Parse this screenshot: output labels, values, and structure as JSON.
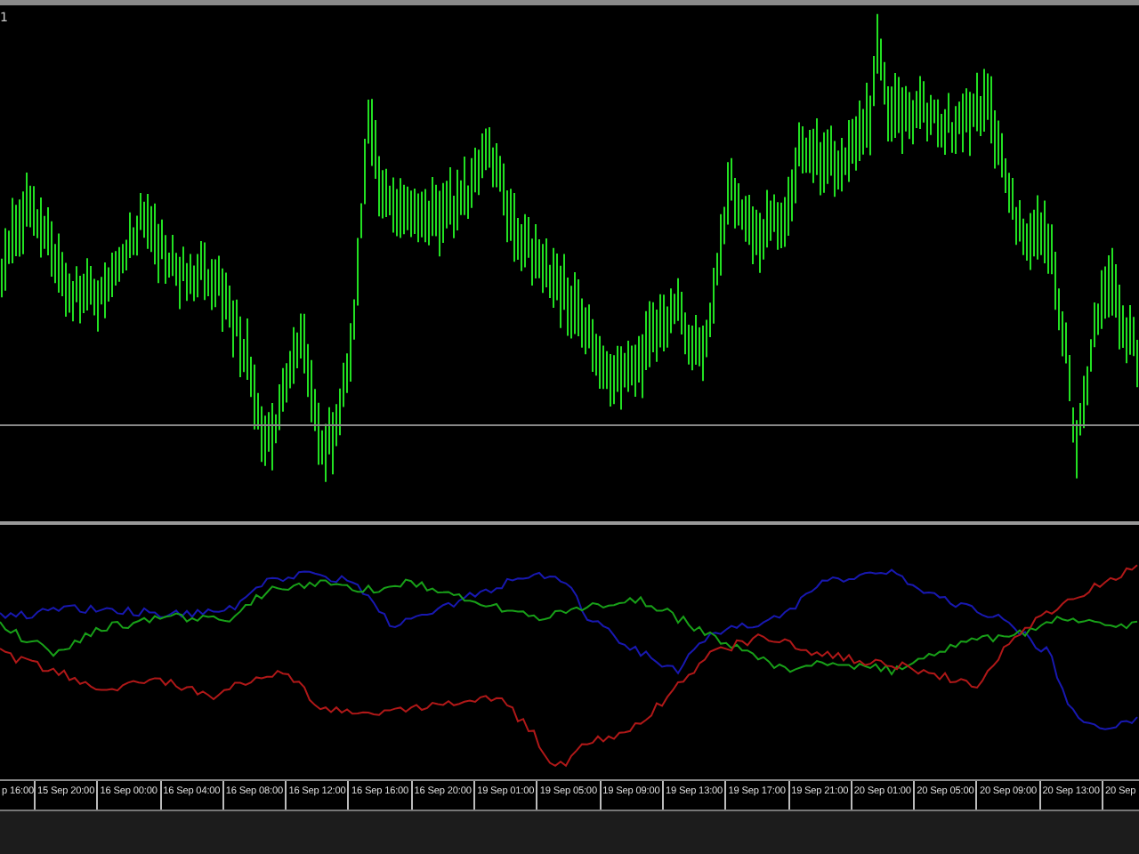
{
  "top_label": "1",
  "indicator": {
    "lines": [
      {
        "color": "#1818b0"
      },
      {
        "color": "#18a018"
      },
      {
        "color": "#b01818"
      }
    ]
  },
  "time_axis": {
    "labels": [
      "p 16:00",
      "15 Sep 20:00",
      "16 Sep 00:00",
      "16 Sep 04:00",
      "16 Sep 08:00",
      "16 Sep 12:00",
      "16 Sep 16:00",
      "16 Sep 20:00",
      "19 Sep 01:00",
      "19 Sep 05:00",
      "19 Sep 09:00",
      "19 Sep 13:00",
      "19 Sep 17:00",
      "19 Sep 21:00",
      "20 Sep 01:00",
      "20 Sep 05:00",
      "20 Sep 09:00",
      "20 Sep 13:00",
      "20 Sep"
    ]
  }
}
